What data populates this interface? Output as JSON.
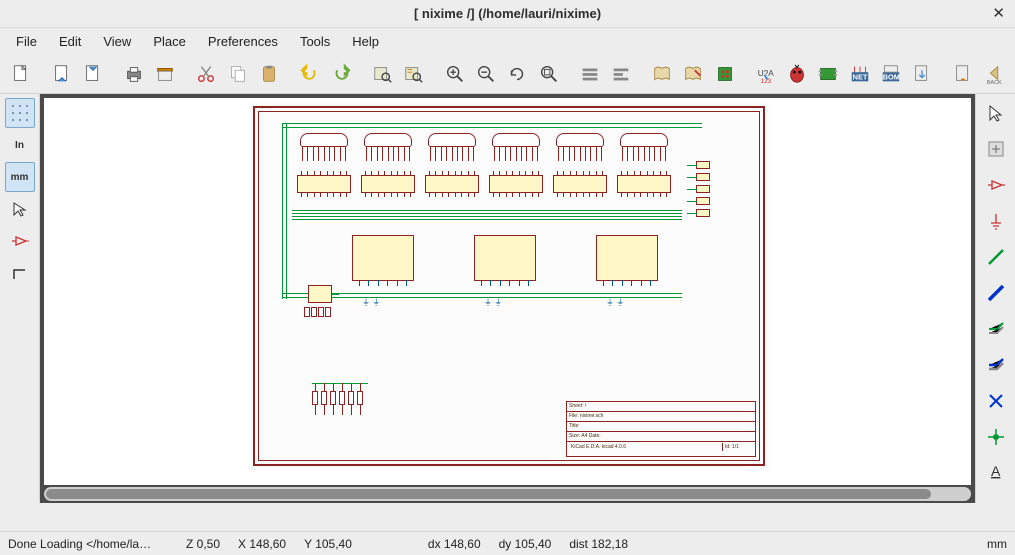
{
  "window": {
    "title": "[ nixime /] (/home/lauri/nixime)",
    "close_glyph": "✕"
  },
  "menu": {
    "file": "File",
    "edit": "Edit",
    "view": "View",
    "place": "Place",
    "preferences": "Preferences",
    "tools": "Tools",
    "help": "Help"
  },
  "left_toolbar": {
    "grid": "grid",
    "inches": "In",
    "mm": "mm",
    "cursor": "cursor",
    "opamp": "opamp",
    "hidden": "hidden"
  },
  "right_toolbar": {
    "select": "select",
    "highlight": "highlight",
    "place_component": "place_component",
    "place_power": "place_power",
    "place_wire": "place_wire",
    "place_bus": "place_bus",
    "wire_entry": "wire_entry",
    "bus_entry": "bus_entry",
    "no_connect": "no_connect",
    "junction": "junction",
    "net_label": "net_label"
  },
  "top_toolbar": {
    "new": "new",
    "open": "open",
    "save": "save",
    "page_settings": "page_settings",
    "cut": "cut",
    "copy": "copy",
    "paste": "paste",
    "undo": "undo",
    "redo": "redo",
    "find": "find",
    "replace": "replace",
    "zoom_in": "zoom_in",
    "zoom_out": "zoom_out",
    "zoom_redraw": "zoom_redraw",
    "zoom_fit": "zoom_fit",
    "navigate_up": "hierarchy_up",
    "leave": "leave_sheet",
    "library_browse": "library_browse",
    "library_edit": "library_edit",
    "footprint": "footprint",
    "annotate": "annotate",
    "erc": "erc",
    "cvpcb": "cvpcb",
    "netlist": "NET",
    "bom": "BOM",
    "export": "export",
    "import": "import",
    "back": "BACK"
  },
  "statusbar": {
    "loading": "Done Loading </home/la…",
    "zoom": "Z 0,50",
    "x": "X 148,60",
    "y": "Y 105,40",
    "dx": "dx 148,60",
    "dy": "dy 105,40",
    "dist": "dist 182,18",
    "units": "mm"
  },
  "titleblock": {
    "r1": "Sheet: /",
    "r2": "File: nixime.sch",
    "r3": "Title:",
    "r4": "Size: A4    Date:",
    "r5": "KiCad E.D.A.  kicad 4.0.6",
    "id": "Id: 1/1"
  }
}
